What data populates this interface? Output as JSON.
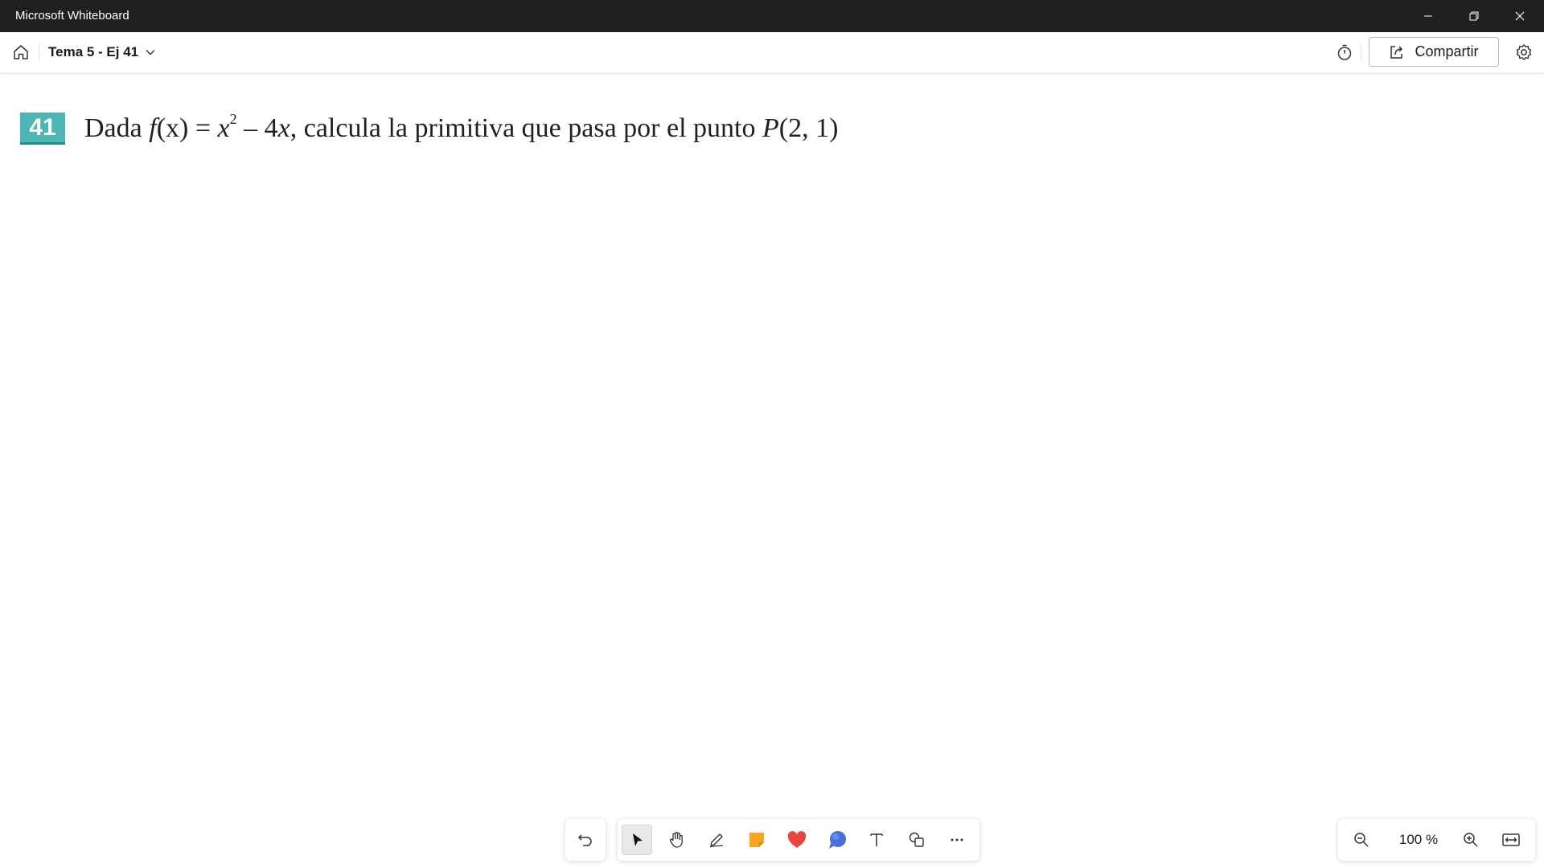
{
  "window": {
    "title": "Microsoft Whiteboard",
    "controls": [
      "minimize-icon",
      "restore-icon",
      "close-icon"
    ]
  },
  "header": {
    "board_name": "Tema 5 - Ej 41",
    "share_label": "Compartir",
    "icons": [
      "home-icon",
      "chevron-down-icon",
      "timer-icon",
      "share-icon",
      "gear-icon"
    ]
  },
  "canvas": {
    "exercise_number": "41",
    "exercise_text": {
      "prefix": "Dada ",
      "func": "f",
      "arg": "(x)",
      "eq": " = ",
      "var": "x",
      "exp": "2",
      "minus": " – 4",
      "var2": "x",
      "suffix": ", calcula la primitiva que pasa por el punto ",
      "point_name": "P",
      "point": "(2, 1)"
    }
  },
  "toolbar": {
    "tools": [
      "undo-icon",
      "select-icon",
      "hand-icon",
      "pen-icon",
      "sticky-note-icon",
      "reaction-icon",
      "chat-icon",
      "text-icon",
      "shapes-icon",
      "more-icon"
    ],
    "selected_tool": "select",
    "zoom_level": "100 %"
  },
  "colors": {
    "titlebar": "#202020",
    "badge": "#4db5b3",
    "sticky": "#f5a623",
    "reaction": "#e8453c",
    "chat": "#4a6fd8"
  }
}
